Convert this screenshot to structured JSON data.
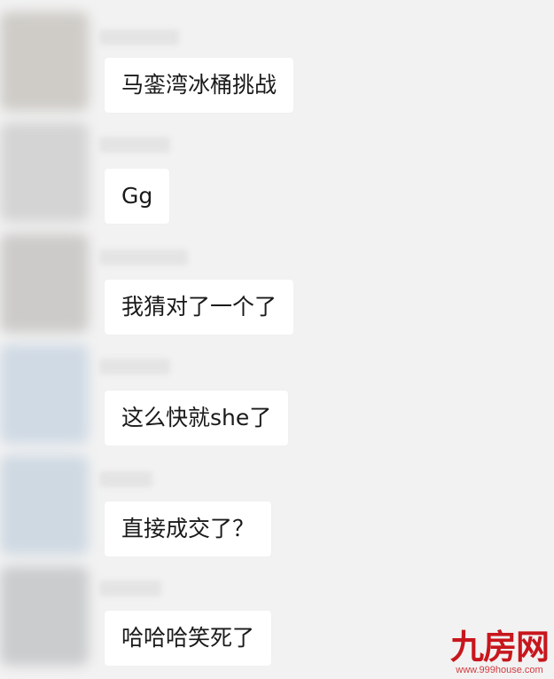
{
  "messages": [
    {
      "text": "马銮湾冰桶挑战",
      "avatar_color": "#c9c6c1"
    },
    {
      "text": "Gg",
      "avatar_color": "#cfcfcf"
    },
    {
      "text": "我猜对了一个了",
      "avatar_color": "#c7c5c3"
    },
    {
      "text": "这么快就she了",
      "avatar_color": "#cad6e2"
    },
    {
      "text": "直接成交了？",
      "avatar_color": "#c9d5e0"
    },
    {
      "text": "哈哈哈笑死了",
      "avatar_color": "#c4c6c8"
    }
  ],
  "watermark": {
    "logo": "九房网",
    "url": "www.999house.com"
  }
}
